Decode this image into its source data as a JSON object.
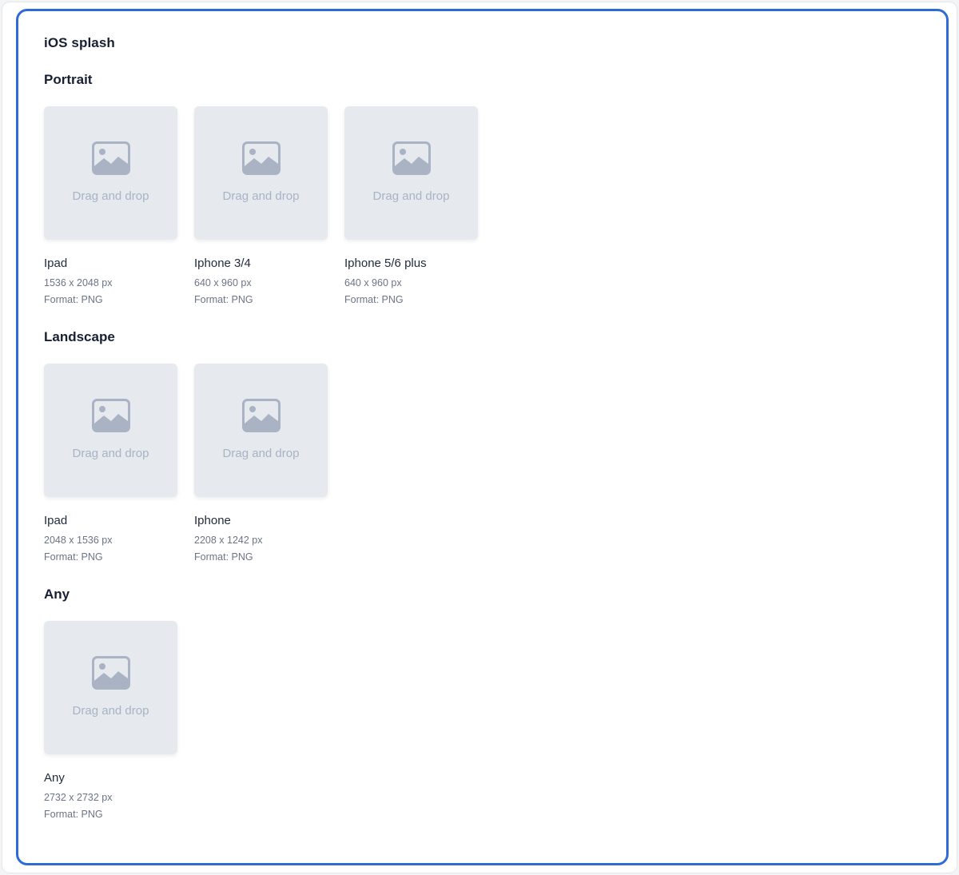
{
  "title": "iOS splash",
  "dropzone_label": "Drag and drop",
  "colors": {
    "panel_border": "#2e6bd9",
    "dropzone_bg": "#e6e9ee",
    "icon": "#a9b3c4"
  },
  "sections": [
    {
      "title": "Portrait",
      "items": [
        {
          "name": "Ipad",
          "size": "1536 x 2048 px",
          "format": "Format: PNG",
          "icon": "image-icon"
        },
        {
          "name": "Iphone 3/4",
          "size": "640 x 960 px",
          "format": "Format: PNG",
          "icon": "image-icon"
        },
        {
          "name": "Iphone 5/6 plus",
          "size": "640 x 960 px",
          "format": "Format: PNG",
          "icon": "image-icon"
        }
      ]
    },
    {
      "title": "Landscape",
      "items": [
        {
          "name": "Ipad",
          "size": "2048 x 1536 px",
          "format": "Format: PNG",
          "icon": "image-icon"
        },
        {
          "name": "Iphone",
          "size": "2208 x 1242 px",
          "format": "Format: PNG",
          "icon": "image-icon"
        }
      ]
    },
    {
      "title": "Any",
      "items": [
        {
          "name": "Any",
          "size": "2732 x 2732 px",
          "format": "Format: PNG",
          "icon": "image-icon"
        }
      ]
    }
  ]
}
